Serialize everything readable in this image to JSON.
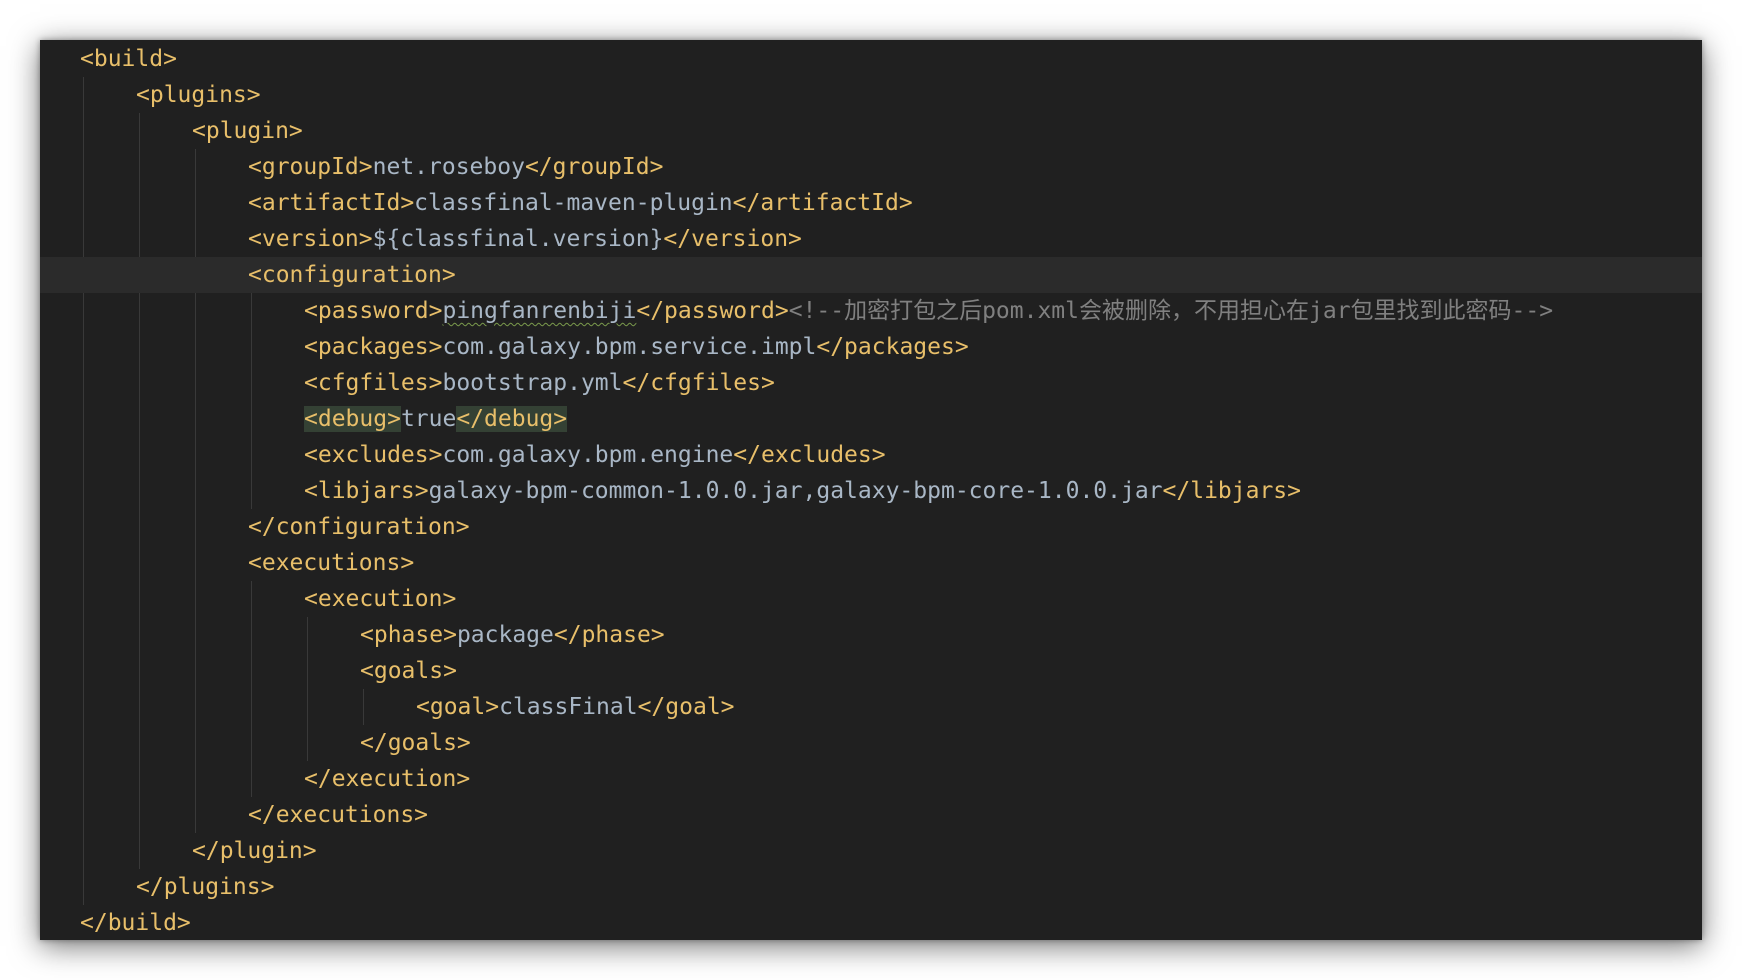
{
  "editor": {
    "language": "xml",
    "colors": {
      "background": "#202020",
      "tag": "#e8bf6a",
      "text": "#a9b7c6",
      "comment": "#808080",
      "current_line": "#2b2b2b",
      "tag_match_highlight": "#344134"
    },
    "current_line_index": 6,
    "lines": [
      {
        "indent": 0,
        "tokens": [
          {
            "t": "tag",
            "v": "<build>"
          }
        ]
      },
      {
        "indent": 1,
        "tokens": [
          {
            "t": "tag",
            "v": "<plugins>"
          }
        ]
      },
      {
        "indent": 2,
        "tokens": [
          {
            "t": "tag",
            "v": "<plugin>"
          }
        ]
      },
      {
        "indent": 3,
        "tokens": [
          {
            "t": "tag",
            "v": "<groupId>"
          },
          {
            "t": "txt",
            "v": "net.roseboy"
          },
          {
            "t": "tag",
            "v": "</groupId>"
          }
        ]
      },
      {
        "indent": 3,
        "tokens": [
          {
            "t": "tag",
            "v": "<artifactId>"
          },
          {
            "t": "txt",
            "v": "classfinal-maven-plugin"
          },
          {
            "t": "tag",
            "v": "</artifactId>"
          }
        ]
      },
      {
        "indent": 3,
        "tokens": [
          {
            "t": "tag",
            "v": "<version>"
          },
          {
            "t": "txt",
            "v": "${classfinal.version}"
          },
          {
            "t": "tag",
            "v": "</version>"
          }
        ]
      },
      {
        "indent": 3,
        "tokens": [
          {
            "t": "tag",
            "v": "<configuration>"
          }
        ]
      },
      {
        "indent": 4,
        "tokens": [
          {
            "t": "tag",
            "v": "<password>"
          },
          {
            "t": "txt",
            "v": "pingfanrenbiji",
            "squiggle": true
          },
          {
            "t": "tag",
            "v": "</password>"
          },
          {
            "t": "cmt",
            "v": "<!--加密打包之后pom.xml会被删除，不用担心在jar包里找到此密码-->"
          }
        ]
      },
      {
        "indent": 4,
        "tokens": [
          {
            "t": "tag",
            "v": "<packages>"
          },
          {
            "t": "txt",
            "v": "com.galaxy.bpm.service.impl"
          },
          {
            "t": "tag",
            "v": "</packages>"
          }
        ]
      },
      {
        "indent": 4,
        "tokens": [
          {
            "t": "tag",
            "v": "<cfgfiles>"
          },
          {
            "t": "txt",
            "v": "bootstrap.yml"
          },
          {
            "t": "tag",
            "v": "</cfgfiles>"
          }
        ]
      },
      {
        "indent": 4,
        "tokens": [
          {
            "t": "tag",
            "v": "<debug>",
            "hl": true
          },
          {
            "t": "txt",
            "v": "true"
          },
          {
            "t": "tag",
            "v": "</debug>",
            "hl": true
          }
        ]
      },
      {
        "indent": 4,
        "tokens": [
          {
            "t": "tag",
            "v": "<excludes>"
          },
          {
            "t": "txt",
            "v": "com.galaxy.bpm.engine"
          },
          {
            "t": "tag",
            "v": "</excludes>"
          }
        ]
      },
      {
        "indent": 4,
        "tokens": [
          {
            "t": "tag",
            "v": "<libjars>"
          },
          {
            "t": "txt",
            "v": "galaxy-bpm-common-1.0.0.jar,galaxy-bpm-core-1.0.0.jar"
          },
          {
            "t": "tag",
            "v": "</libjars>"
          }
        ]
      },
      {
        "indent": 3,
        "tokens": [
          {
            "t": "tag",
            "v": "</configuration>"
          }
        ]
      },
      {
        "indent": 3,
        "tokens": [
          {
            "t": "tag",
            "v": "<executions>"
          }
        ]
      },
      {
        "indent": 4,
        "tokens": [
          {
            "t": "tag",
            "v": "<execution>"
          }
        ]
      },
      {
        "indent": 5,
        "tokens": [
          {
            "t": "tag",
            "v": "<phase>"
          },
          {
            "t": "txt",
            "v": "package"
          },
          {
            "t": "tag",
            "v": "</phase>"
          }
        ]
      },
      {
        "indent": 5,
        "tokens": [
          {
            "t": "tag",
            "v": "<goals>"
          }
        ]
      },
      {
        "indent": 6,
        "tokens": [
          {
            "t": "tag",
            "v": "<goal>"
          },
          {
            "t": "txt",
            "v": "classFinal"
          },
          {
            "t": "tag",
            "v": "</goal>"
          }
        ]
      },
      {
        "indent": 5,
        "tokens": [
          {
            "t": "tag",
            "v": "</goals>"
          }
        ]
      },
      {
        "indent": 4,
        "tokens": [
          {
            "t": "tag",
            "v": "</execution>"
          }
        ]
      },
      {
        "indent": 3,
        "tokens": [
          {
            "t": "tag",
            "v": "</executions>"
          }
        ]
      },
      {
        "indent": 2,
        "tokens": [
          {
            "t": "tag",
            "v": "</plugin>"
          }
        ]
      },
      {
        "indent": 1,
        "tokens": [
          {
            "t": "tag",
            "v": "</plugins>"
          }
        ]
      },
      {
        "indent": 0,
        "tokens": [
          {
            "t": "tag",
            "v": "</build>"
          }
        ]
      }
    ]
  }
}
